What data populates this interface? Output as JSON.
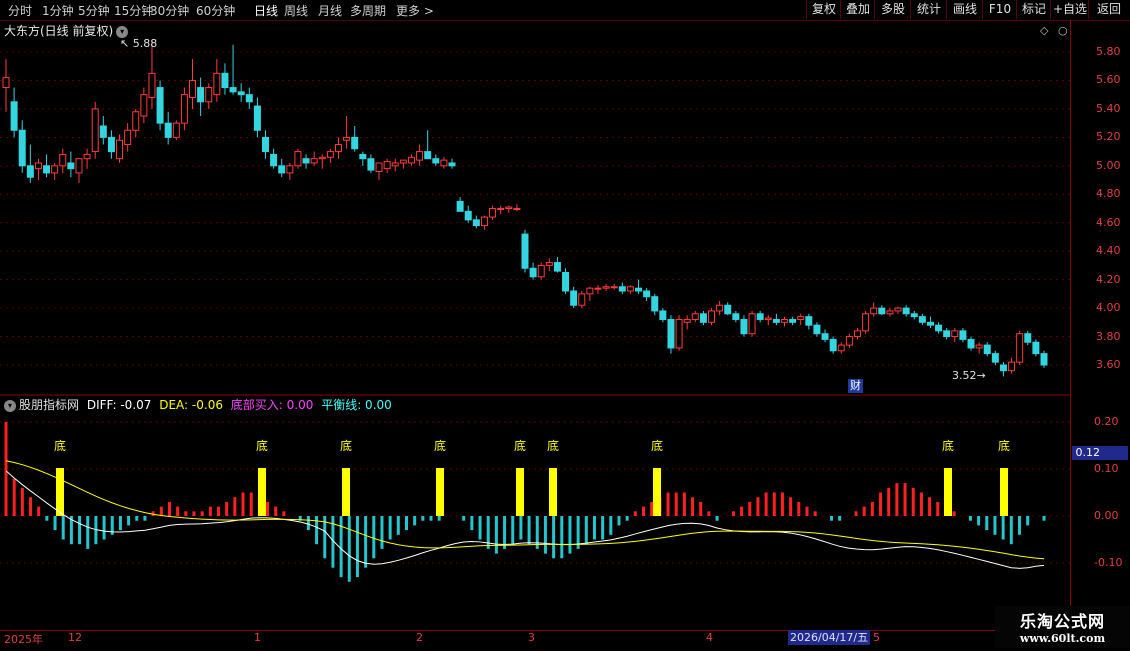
{
  "toolbar": {
    "periods": [
      "分时",
      "1分钟",
      "5分钟",
      "15分钟",
      "30分钟",
      "60分钟",
      "日线",
      "周线",
      "月线",
      "多周期",
      "更多 >"
    ],
    "active_period": "日线",
    "buttons": [
      "复权",
      "叠加",
      "多股",
      "统计",
      "画线",
      "F10",
      "标记",
      "+自选",
      "返回"
    ]
  },
  "price_panel": {
    "title": "大东方(日线 前复权)",
    "high_label": "5.88",
    "low_label": "3.52",
    "finance_badge": "财",
    "ticks": [
      "5.80",
      "5.60",
      "5.40",
      "5.20",
      "5.00",
      "4.80",
      "4.60",
      "4.40",
      "4.20",
      "4.00",
      "3.80",
      "3.60"
    ]
  },
  "indicator_panel": {
    "name": "股朋指标网",
    "diff_label": "DIFF: -0.07",
    "dea_label": "DEA: -0.06",
    "buy_label": "底部买入: 0.00",
    "balance_label": "平衡线: 0.00",
    "bottom_marker": "底",
    "ticks": [
      "0.20",
      "0.10",
      "0.00",
      "-0.10"
    ],
    "current_value": "0.12"
  },
  "date_axis": {
    "labels": [
      "2025年",
      "12",
      "1",
      "2",
      "3",
      "4",
      "2026/04/17/五",
      "5"
    ]
  },
  "watermark": {
    "line1": "乐淘公式网",
    "line2": "www.60lt.com"
  },
  "colors": {
    "up": "#ff3b3b",
    "down": "#33d6e0",
    "diff_line": "#ffffff",
    "dea_line": "#ffff00",
    "bottom_bar": "#ffff00",
    "axis": "#8b0000"
  },
  "chart_data": {
    "type": "candlestick",
    "title": "大东方(日线 前复权)",
    "ylim": [
      3.5,
      5.95
    ],
    "ohlc": [
      [
        5.55,
        5.75,
        5.38,
        5.62
      ],
      [
        5.45,
        5.55,
        5.2,
        5.25
      ],
      [
        5.25,
        5.32,
        4.95,
        5.0
      ],
      [
        5.0,
        5.15,
        4.88,
        4.92
      ],
      [
        4.98,
        5.05,
        4.9,
        5.02
      ],
      [
        5.0,
        5.08,
        4.92,
        4.95
      ],
      [
        4.95,
        5.02,
        4.9,
        5.0
      ],
      [
        5.0,
        5.12,
        4.95,
        5.08
      ],
      [
        5.02,
        5.1,
        4.92,
        4.98
      ],
      [
        4.95,
        5.05,
        4.88,
        5.05
      ],
      [
        5.05,
        5.12,
        4.98,
        5.08
      ],
      [
        5.1,
        5.45,
        5.05,
        5.4
      ],
      [
        5.28,
        5.35,
        5.15,
        5.2
      ],
      [
        5.2,
        5.25,
        5.05,
        5.1
      ],
      [
        5.05,
        5.22,
        5.02,
        5.18
      ],
      [
        5.15,
        5.3,
        5.1,
        5.25
      ],
      [
        5.25,
        5.4,
        5.2,
        5.38
      ],
      [
        5.35,
        5.55,
        5.3,
        5.5
      ],
      [
        5.48,
        5.88,
        5.4,
        5.65
      ],
      [
        5.55,
        5.6,
        5.25,
        5.3
      ],
      [
        5.3,
        5.38,
        5.15,
        5.2
      ],
      [
        5.2,
        5.32,
        5.18,
        5.3
      ],
      [
        5.3,
        5.55,
        5.25,
        5.5
      ],
      [
        5.48,
        5.75,
        5.4,
        5.6
      ],
      [
        5.55,
        5.62,
        5.35,
        5.45
      ],
      [
        5.45,
        5.58,
        5.4,
        5.55
      ],
      [
        5.5,
        5.75,
        5.45,
        5.65
      ],
      [
        5.65,
        5.72,
        5.5,
        5.55
      ],
      [
        5.55,
        5.85,
        5.5,
        5.52
      ],
      [
        5.52,
        5.58,
        5.45,
        5.5
      ],
      [
        5.5,
        5.55,
        5.4,
        5.45
      ],
      [
        5.42,
        5.48,
        5.2,
        5.25
      ],
      [
        5.2,
        5.25,
        5.05,
        5.1
      ],
      [
        5.08,
        5.12,
        4.98,
        5.0
      ],
      [
        5.0,
        5.05,
        4.92,
        4.95
      ],
      [
        4.95,
        5.02,
        4.9,
        5.0
      ],
      [
        5.0,
        5.12,
        4.98,
        5.1
      ],
      [
        5.05,
        5.08,
        4.98,
        5.02
      ],
      [
        5.02,
        5.1,
        5.0,
        5.05
      ],
      [
        5.05,
        5.08,
        4.98,
        5.06
      ],
      [
        5.06,
        5.12,
        5.02,
        5.1
      ],
      [
        5.1,
        5.2,
        5.05,
        5.15
      ],
      [
        5.18,
        5.35,
        5.12,
        5.2
      ],
      [
        5.2,
        5.28,
        5.1,
        5.12
      ],
      [
        5.08,
        5.1,
        5.0,
        5.05
      ],
      [
        5.05,
        5.08,
        4.95,
        4.97
      ],
      [
        4.96,
        5.0,
        4.9,
        5.02
      ],
      [
        4.98,
        5.05,
        4.95,
        5.03
      ],
      [
        5.0,
        5.05,
        4.96,
        5.02
      ],
      [
        5.02,
        5.04,
        4.98,
        5.04
      ],
      [
        5.02,
        5.08,
        5.0,
        5.06
      ],
      [
        5.04,
        5.15,
        5.0,
        5.1
      ],
      [
        5.1,
        5.25,
        5.05,
        5.05
      ],
      [
        5.05,
        5.08,
        5.0,
        5.02
      ],
      [
        5.0,
        5.06,
        4.98,
        5.04
      ],
      [
        5.02,
        5.05,
        4.98,
        5.0
      ],
      [
        4.75,
        4.78,
        4.68,
        4.68
      ],
      [
        4.68,
        4.72,
        4.6,
        4.62
      ],
      [
        4.62,
        4.65,
        4.56,
        4.58
      ],
      [
        4.58,
        4.65,
        4.55,
        4.64
      ],
      [
        4.64,
        4.72,
        4.62,
        4.7
      ],
      [
        4.7,
        4.72,
        4.66,
        4.7
      ],
      [
        4.7,
        4.72,
        4.67,
        4.71
      ],
      [
        4.7,
        4.73,
        4.68,
        4.7
      ],
      [
        4.52,
        4.55,
        4.25,
        4.28
      ],
      [
        4.28,
        4.32,
        4.2,
        4.22
      ],
      [
        4.22,
        4.32,
        4.2,
        4.3
      ],
      [
        4.3,
        4.35,
        4.26,
        4.32
      ],
      [
        4.32,
        4.36,
        4.25,
        4.26
      ],
      [
        4.25,
        4.28,
        4.1,
        4.12
      ],
      [
        4.12,
        4.15,
        4.0,
        4.02
      ],
      [
        4.02,
        4.12,
        4.0,
        4.1
      ],
      [
        4.1,
        4.15,
        4.05,
        4.14
      ],
      [
        4.14,
        4.16,
        4.1,
        4.14
      ],
      [
        4.14,
        4.17,
        4.12,
        4.15
      ],
      [
        4.15,
        4.17,
        4.13,
        4.15
      ],
      [
        4.15,
        4.18,
        4.1,
        4.12
      ],
      [
        4.12,
        4.16,
        4.1,
        4.15
      ],
      [
        4.14,
        4.2,
        4.1,
        4.12
      ],
      [
        4.12,
        4.14,
        4.05,
        4.08
      ],
      [
        4.08,
        4.1,
        3.95,
        3.98
      ],
      [
        3.98,
        4.0,
        3.9,
        3.92
      ],
      [
        3.92,
        3.95,
        3.68,
        3.72
      ],
      [
        3.72,
        3.95,
        3.7,
        3.92
      ],
      [
        3.9,
        3.95,
        3.85,
        3.92
      ],
      [
        3.92,
        3.98,
        3.9,
        3.96
      ],
      [
        3.96,
        3.98,
        3.88,
        3.9
      ],
      [
        3.9,
        4.0,
        3.88,
        3.98
      ],
      [
        3.98,
        4.05,
        3.95,
        4.02
      ],
      [
        4.02,
        4.04,
        3.95,
        3.96
      ],
      [
        3.96,
        3.98,
        3.9,
        3.92
      ],
      [
        3.92,
        3.95,
        3.8,
        3.82
      ],
      [
        3.82,
        3.98,
        3.8,
        3.96
      ],
      [
        3.96,
        3.98,
        3.9,
        3.92
      ],
      [
        3.92,
        3.95,
        3.88,
        3.93
      ],
      [
        3.92,
        3.96,
        3.88,
        3.9
      ],
      [
        3.9,
        3.94,
        3.87,
        3.92
      ],
      [
        3.92,
        3.94,
        3.88,
        3.9
      ],
      [
        3.92,
        3.96,
        3.88,
        3.94
      ],
      [
        3.94,
        3.96,
        3.85,
        3.88
      ],
      [
        3.88,
        3.9,
        3.8,
        3.82
      ],
      [
        3.82,
        3.85,
        3.76,
        3.78
      ],
      [
        3.78,
        3.8,
        3.68,
        3.7
      ],
      [
        3.7,
        3.76,
        3.68,
        3.74
      ],
      [
        3.74,
        3.82,
        3.72,
        3.8
      ],
      [
        3.8,
        3.86,
        3.78,
        3.84
      ],
      [
        3.84,
        3.98,
        3.82,
        3.96
      ],
      [
        3.96,
        4.04,
        3.94,
        4.0
      ],
      [
        4.0,
        4.02,
        3.95,
        3.96
      ],
      [
        3.96,
        4.0,
        3.94,
        3.98
      ],
      [
        3.98,
        4.01,
        3.96,
        4.0
      ],
      [
        4.0,
        4.02,
        3.94,
        3.96
      ],
      [
        3.96,
        3.98,
        3.92,
        3.94
      ],
      [
        3.94,
        3.96,
        3.88,
        3.9
      ],
      [
        3.9,
        3.94,
        3.86,
        3.88
      ],
      [
        3.88,
        3.9,
        3.82,
        3.84
      ],
      [
        3.84,
        3.86,
        3.78,
        3.8
      ],
      [
        3.8,
        3.86,
        3.76,
        3.84
      ],
      [
        3.84,
        3.86,
        3.76,
        3.78
      ],
      [
        3.78,
        3.8,
        3.7,
        3.72
      ],
      [
        3.72,
        3.76,
        3.68,
        3.74
      ],
      [
        3.74,
        3.76,
        3.66,
        3.68
      ],
      [
        3.68,
        3.7,
        3.6,
        3.62
      ],
      [
        3.6,
        3.62,
        3.52,
        3.56
      ],
      [
        3.56,
        3.65,
        3.54,
        3.62
      ],
      [
        3.62,
        3.84,
        3.6,
        3.82
      ],
      [
        3.82,
        3.84,
        3.74,
        3.76
      ],
      [
        3.76,
        3.78,
        3.66,
        3.68
      ],
      [
        3.68,
        3.7,
        3.58,
        3.6
      ]
    ],
    "macd": [
      0.2,
      0.08,
      0.06,
      0.04,
      0.02,
      -0.01,
      -0.03,
      -0.05,
      -0.06,
      -0.06,
      -0.07,
      -0.06,
      -0.05,
      -0.04,
      -0.03,
      -0.02,
      -0.01,
      -0.01,
      0.01,
      0.02,
      0.03,
      0.02,
      0.01,
      0.01,
      0.01,
      0.02,
      0.02,
      0.03,
      0.04,
      0.05,
      0.05,
      0.04,
      0.03,
      0.02,
      0.01,
      0.0,
      -0.01,
      -0.03,
      -0.06,
      -0.09,
      -0.11,
      -0.13,
      -0.14,
      -0.13,
      -0.11,
      -0.09,
      -0.07,
      -0.05,
      -0.04,
      -0.03,
      -0.02,
      -0.01,
      -0.01,
      -0.01,
      0.0,
      0.0,
      -0.01,
      -0.03,
      -0.05,
      -0.07,
      -0.08,
      -0.07,
      -0.06,
      -0.05,
      -0.06,
      -0.07,
      -0.08,
      -0.09,
      -0.09,
      -0.08,
      -0.07,
      -0.06,
      -0.05,
      -0.05,
      -0.04,
      -0.02,
      -0.01,
      0.01,
      0.02,
      0.03,
      0.04,
      0.05,
      0.05,
      0.05,
      0.04,
      0.03,
      0.01,
      -0.01,
      0.0,
      0.01,
      0.02,
      0.03,
      0.04,
      0.05,
      0.05,
      0.05,
      0.04,
      0.03,
      0.02,
      0.01,
      0.0,
      -0.01,
      -0.01,
      0.0,
      0.01,
      0.02,
      0.03,
      0.05,
      0.06,
      0.07,
      0.07,
      0.06,
      0.05,
      0.04,
      0.03,
      0.02,
      0.01,
      0.0,
      -0.01,
      -0.02,
      -0.03,
      -0.04,
      -0.05,
      -0.06,
      -0.04,
      -0.02,
      0.0,
      -0.01
    ]
  }
}
